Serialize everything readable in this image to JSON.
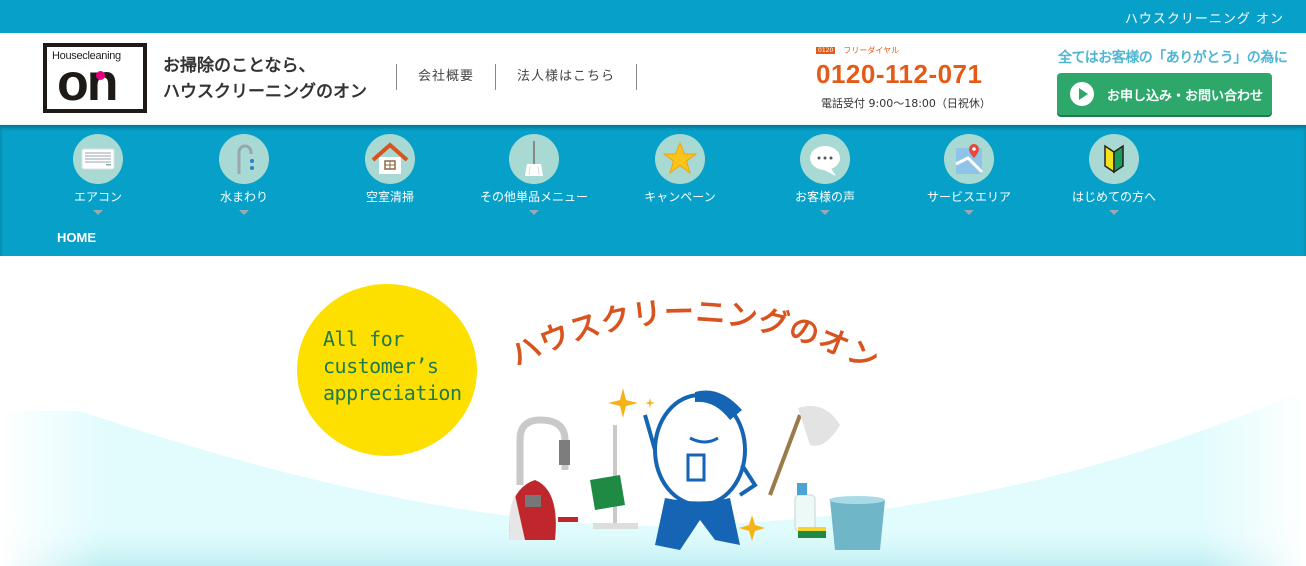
{
  "topbar": {
    "site_name": "ハウスクリーニング オン"
  },
  "header": {
    "logo": {
      "small_text": "Housecleaning",
      "big_text": "on",
      "accent_color": "#e4007f"
    },
    "tagline_line1": "お掃除のことなら、",
    "tagline_line2": "ハウスクリーニングのオン",
    "links": [
      {
        "label": "会社概要"
      },
      {
        "label": "法人様はこちら"
      }
    ],
    "phone": {
      "badge": "0120",
      "free_label": "フリーダイヤル",
      "number": "0120-112-071",
      "hours": "電話受付 9:00〜18:00（日祝休）"
    },
    "slogan": "全てはお客様の「ありがとう」の為に",
    "cta_label": "お申し込み・お問い合わせ"
  },
  "nav": {
    "items": [
      {
        "label": "エアコン",
        "icon": "air-conditioner-icon",
        "has_dropdown": true
      },
      {
        "label": "水まわり",
        "icon": "faucet-icon",
        "has_dropdown": true
      },
      {
        "label": "空室清掃",
        "icon": "house-icon",
        "has_dropdown": false
      },
      {
        "label": "その他単品メニュー",
        "icon": "broom-icon",
        "has_dropdown": true
      },
      {
        "label": "キャンペーン",
        "icon": "star-icon",
        "has_dropdown": false
      },
      {
        "label": "お客様の声",
        "icon": "speech-bubble-icon",
        "has_dropdown": true
      },
      {
        "label": "サービスエリア",
        "icon": "map-icon",
        "has_dropdown": true
      },
      {
        "label": "はじめての方へ",
        "icon": "beginner-mark-icon",
        "has_dropdown": true
      }
    ],
    "breadcrumb": "HOME"
  },
  "hero": {
    "badge_line1": "All for",
    "badge_line2": "customer’s",
    "badge_line3": "appreciation",
    "title": "ハウスクリーニングのオン"
  },
  "colors": {
    "brand_blue": "#06a0c8",
    "phone_orange": "#e35b16",
    "cta_green": "#2ea76b",
    "badge_yellow": "#fde000",
    "badge_text": "#1f7a4c",
    "hero_title": "#d9531e",
    "mascot_blue": "#1565b4"
  }
}
